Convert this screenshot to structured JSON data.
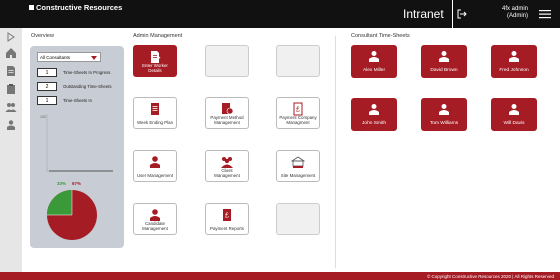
{
  "header": {
    "logo_text": "Constructive Resources",
    "title": "Intranet",
    "user_name": "4fx admin",
    "user_role": "(Admin)"
  },
  "overview": {
    "title": "Overview",
    "select_value": "All Consultants",
    "stats": [
      {
        "value": "1",
        "label": "Time-Sheets In Progress"
      },
      {
        "value": "2",
        "label": "Outstanding Time-Sheets"
      },
      {
        "value": "1",
        "label": "Time-Sheets In"
      }
    ],
    "mini_chart_axis_label": "100",
    "pie_green_label": "33%",
    "pie_red_label": "67%",
    "pie_green_color": "#3a9a3a",
    "pie_red_color": "#a51c24"
  },
  "admin": {
    "title": "Admin Management",
    "tiles": [
      {
        "label": "Enter Worker Details"
      },
      {
        "label": ""
      },
      {
        "label": ""
      },
      {
        "label": "Week Ending Plan"
      },
      {
        "label": "Payment Method Management"
      },
      {
        "label": "Payment Company Managment"
      },
      {
        "label": "User Management"
      },
      {
        "label": "Client Management"
      },
      {
        "label": "Site Management"
      },
      {
        "label": "Candidate Management"
      },
      {
        "label": "Payment Reports"
      },
      {
        "label": ""
      }
    ]
  },
  "consultants": {
    "title": "Consultant Time-Sheets",
    "people": [
      "Alex Miller",
      "David Brown",
      "Fred Johnson",
      "John Smith",
      "Tom Williams",
      "Will Davis"
    ]
  },
  "footer": {
    "copyright": "© Copyright Constructive Resources 2020   |   All Rights Reserved"
  },
  "colors": {
    "brand_red": "#a51c24",
    "header_black": "#111111"
  }
}
